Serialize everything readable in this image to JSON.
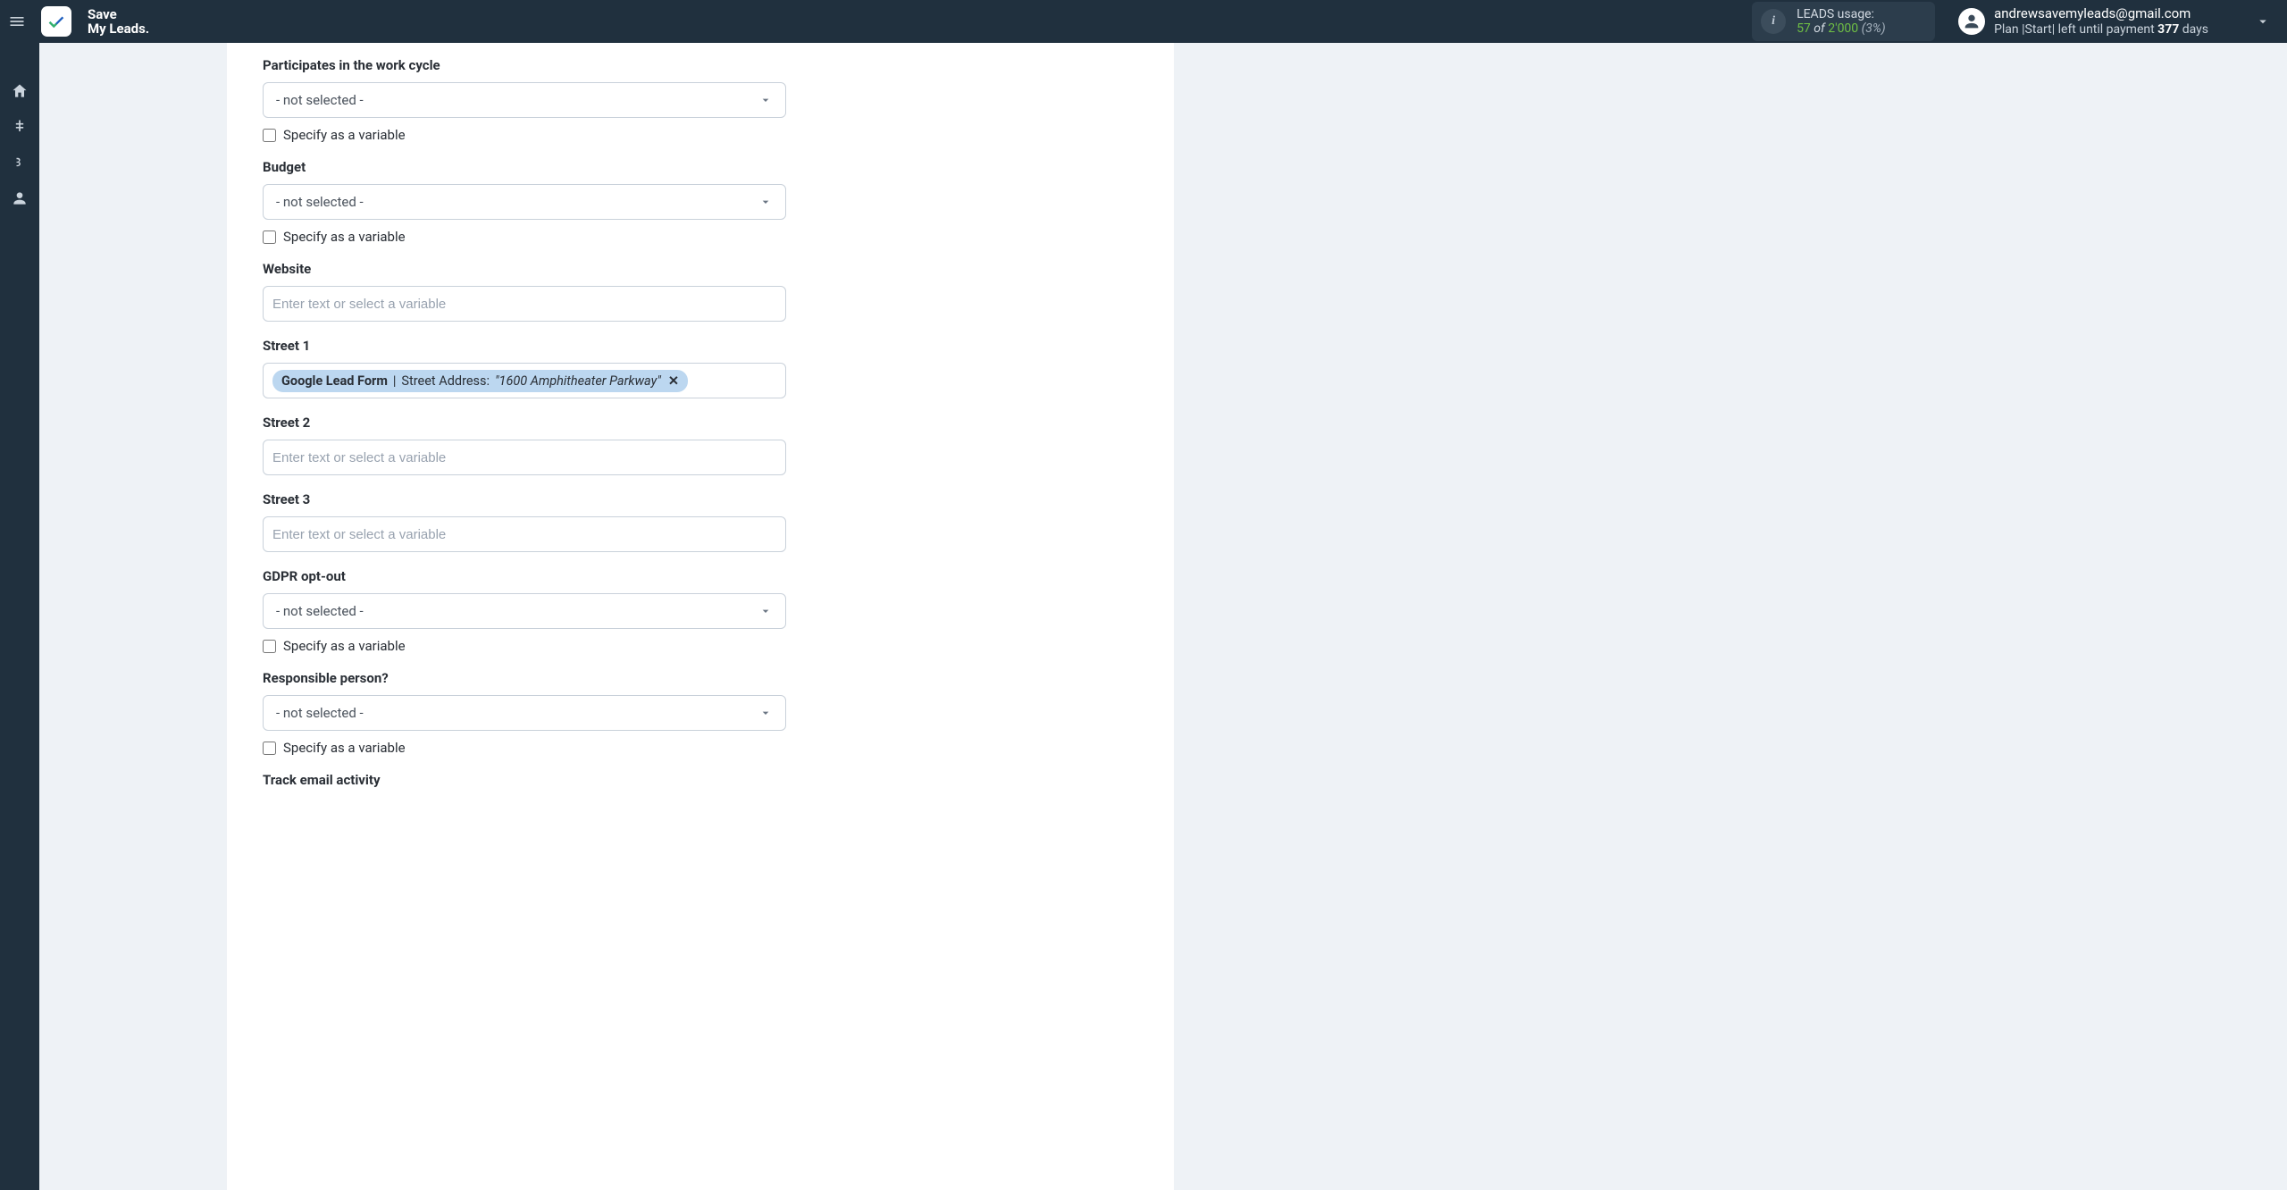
{
  "brand": {
    "line1": "Save",
    "line2": "My Leads."
  },
  "leads_usage": {
    "label": "LEADS usage:",
    "used": "57",
    "of_word": "of",
    "total": "2'000",
    "percent": "(3%)"
  },
  "account": {
    "email": "andrewsavemyleads@gmail.com",
    "plan_prefix": "Plan ",
    "plan_name": "|Start|",
    "plan_middle": " left until payment ",
    "plan_days": "377",
    "plan_suffix": " days"
  },
  "labels": {
    "not_selected": "- not selected -",
    "specify_variable": "Specify as a variable",
    "input_placeholder": "Enter text or select a variable"
  },
  "fields": {
    "participates": {
      "label": "Participates in the work cycle"
    },
    "budget": {
      "label": "Budget"
    },
    "website": {
      "label": "Website"
    },
    "street1": {
      "label": "Street 1"
    },
    "street2": {
      "label": "Street 2"
    },
    "street3": {
      "label": "Street 3"
    },
    "gdpr": {
      "label": "GDPR opt-out"
    },
    "responsible": {
      "label": "Responsible person?"
    },
    "track_email": {
      "label": "Track email activity"
    }
  },
  "street1_pill": {
    "source": "Google Lead Form",
    "pipe": " | ",
    "field": "Street Address: ",
    "value": "\"1600 Amphitheater Parkway\"",
    "close": "✕"
  }
}
